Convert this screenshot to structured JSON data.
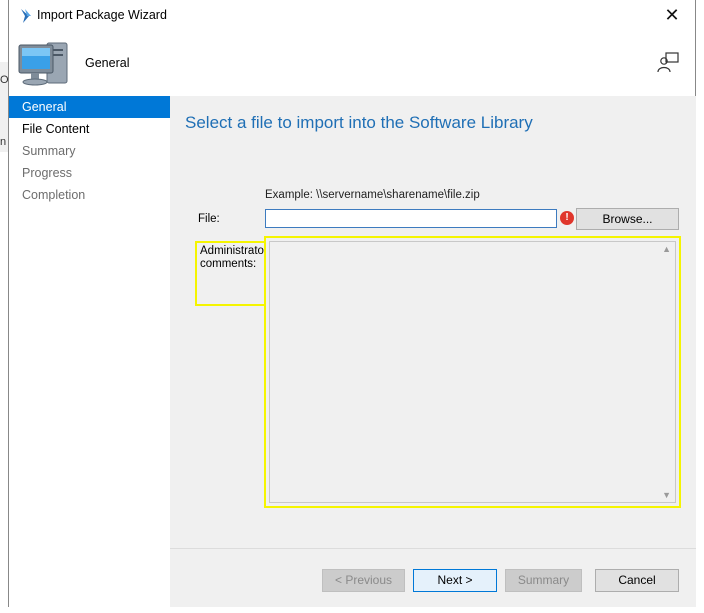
{
  "window": {
    "title": "Import Package Wizard",
    "close_glyph": "✕"
  },
  "background": {
    "fragments": [
      "O",
      "n"
    ]
  },
  "header": {
    "title": "General"
  },
  "sidebar": {
    "items": [
      {
        "label": "General",
        "state": "active"
      },
      {
        "label": "File Content",
        "state": "current"
      },
      {
        "label": "Summary",
        "state": "pending"
      },
      {
        "label": "Progress",
        "state": "pending"
      },
      {
        "label": "Completion",
        "state": "pending"
      }
    ]
  },
  "main": {
    "heading": "Select a file to import into the Software Library",
    "example": "Example: \\\\servername\\sharename\\file.zip",
    "file_label": "File:",
    "file_value": "",
    "error_glyph": "!",
    "browse_label": "Browse...",
    "admin_comments_label": "Administrator comments:",
    "admin_comments_value": ""
  },
  "footer": {
    "previous_label": "< Previous",
    "next_label": "Next >",
    "summary_label": "Summary",
    "cancel_label": "Cancel"
  },
  "colors": {
    "accent": "#0078d7",
    "heading": "#1f6fb5",
    "highlight": "#f5f500",
    "error": "#e0362c"
  },
  "icons": [
    "wizard-arrow-icon",
    "computer-icon",
    "feedback-icon",
    "error-icon",
    "close-icon",
    "scroll-up-icon",
    "scroll-down-icon"
  ]
}
